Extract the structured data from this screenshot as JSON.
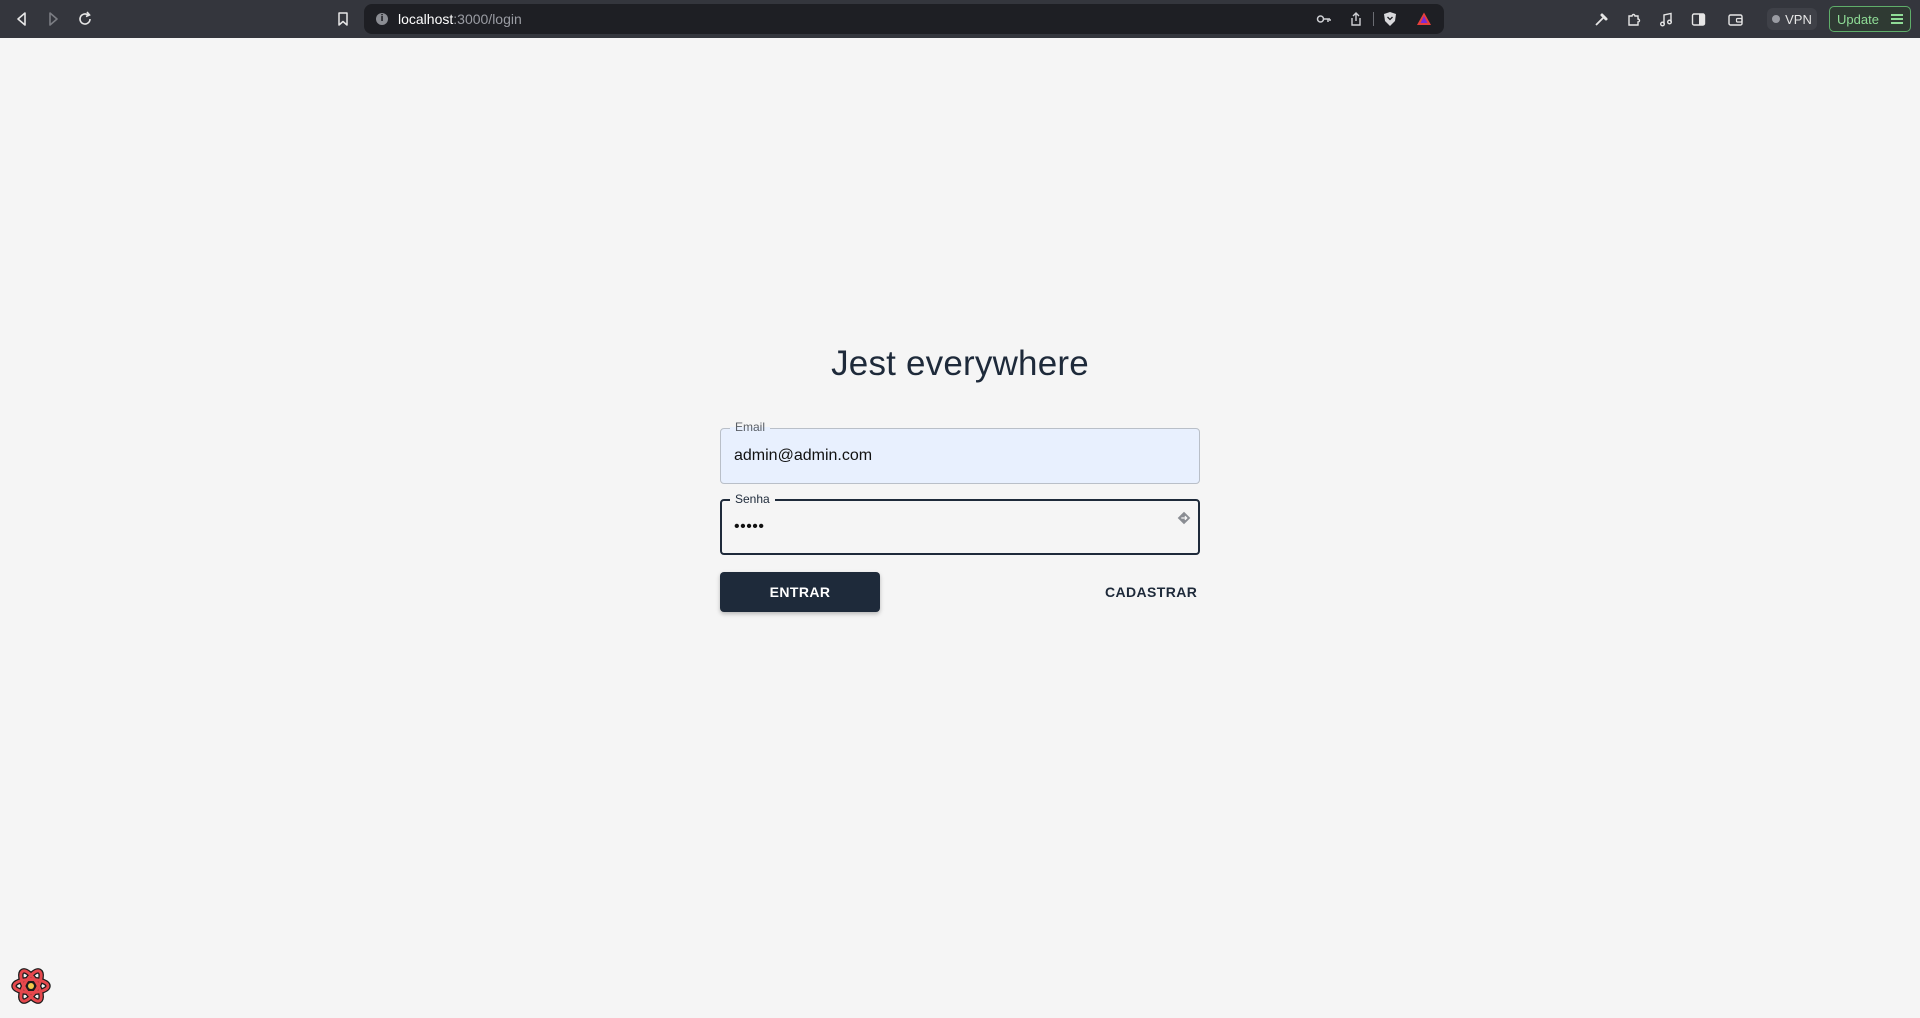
{
  "browser": {
    "url_host": "localhost",
    "url_path": ":3000/login",
    "vpn_label": "VPN",
    "update_label": "Update",
    "icons": {
      "back": "back-arrow-icon",
      "forward": "forward-arrow-icon",
      "reload": "reload-icon",
      "bookmark": "bookmark-icon",
      "site_info": "info-icon",
      "key": "key-icon",
      "share": "share-icon",
      "brave_shield": "brave-shield-icon",
      "brave_rewards": "brave-rewards-triangle-icon",
      "eyedropper": "eyedropper-icon",
      "extensions": "puzzle-icon",
      "media": "music-note-icon",
      "sidebar": "sidebar-icon",
      "wallet": "wallet-icon",
      "menu": "hamburger-menu-icon"
    }
  },
  "login": {
    "title": "Jest everywhere",
    "email_label": "Email",
    "email_value": "admin@admin.com",
    "password_label": "Senha",
    "password_value": "•••••",
    "submit_label": "ENTRAR",
    "register_label": "CADASTRAR"
  },
  "colors": {
    "primary": "#1e2a3a",
    "page_background": "#f5f5f5",
    "autofill_background": "#e8f0fe",
    "browser_chrome": "#34363d",
    "update_accent": "#8fdc96"
  }
}
